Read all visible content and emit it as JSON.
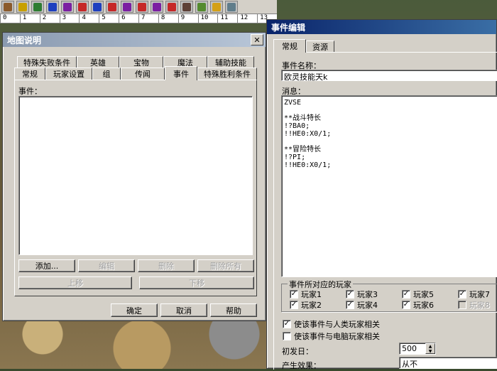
{
  "ruler": [
    "0",
    "1",
    "2",
    "3",
    "4",
    "5",
    "6",
    "7",
    "8",
    "9",
    "10",
    "11",
    "12",
    "13"
  ],
  "toolbar_icons": [
    "shovel-icon",
    "pencil-icon",
    "tree-icon",
    "blue-flag-icon",
    "mixed-flag-icon",
    "red-flag-icon",
    "blue-flag-icon",
    "red-flag-icon",
    "mixed-flag-icon",
    "red-flag-icon",
    "mixed-flag-icon",
    "red-flag-icon",
    "building-icon",
    "creature-icon",
    "trophy-icon",
    "helmet-icon"
  ],
  "left_window": {
    "title": "地图说明",
    "tabs_row1": [
      "特殊失败条件",
      "英雄",
      "宝物",
      "魔法",
      "辅助技能"
    ],
    "tabs_row2": [
      "常规",
      "玩家设置",
      "组",
      "传闻",
      "事件",
      "特殊胜利条件"
    ],
    "active_tab": "事件",
    "events_label": "事件：",
    "buttons": {
      "add": "添加...",
      "edit": "编辑",
      "delete": "删除",
      "delete_all": "删除所有",
      "move_up": "上移",
      "move_down": "下移"
    },
    "footer": {
      "ok": "确定",
      "cancel": "取消",
      "help": "帮助"
    }
  },
  "right_window": {
    "title": "事件编辑",
    "tabs": [
      "常规",
      "资源"
    ],
    "event_name_label": "事件名称：",
    "event_name_value": "欧灵技能天k",
    "message_label": "消息：",
    "message_lines": [
      "ZVSE",
      "",
      "**战斗特长",
      "!?BA0;",
      "!!HE0:X0/1;",
      "",
      "**冒险特长",
      "!?PI;",
      "!!HE0:X0/1;"
    ],
    "players_group_title": "事件所对应的玩家",
    "players": [
      {
        "label": "玩家1",
        "checked": true,
        "enabled": true
      },
      {
        "label": "玩家3",
        "checked": true,
        "enabled": true
      },
      {
        "label": "玩家5",
        "checked": true,
        "enabled": true
      },
      {
        "label": "玩家7",
        "checked": true,
        "enabled": true
      },
      {
        "label": "玩家2",
        "checked": true,
        "enabled": true
      },
      {
        "label": "玩家4",
        "checked": true,
        "enabled": true
      },
      {
        "label": "玩家6",
        "checked": true,
        "enabled": true
      },
      {
        "label": "玩家8",
        "checked": false,
        "enabled": false
      }
    ],
    "human_related_label": "使该事件与人类玩家相关",
    "human_related_checked": true,
    "computer_related_label": "使该事件与电脑玩家相关",
    "computer_related_checked": false,
    "first_day_label": "初发日：",
    "first_day_value": "500",
    "effect_label": "产生效果：",
    "effect_value": "从不"
  },
  "colors": {
    "active_title": "#0a246a",
    "inactive_title": "#8a9ab0",
    "face": "#d4d0c8"
  }
}
